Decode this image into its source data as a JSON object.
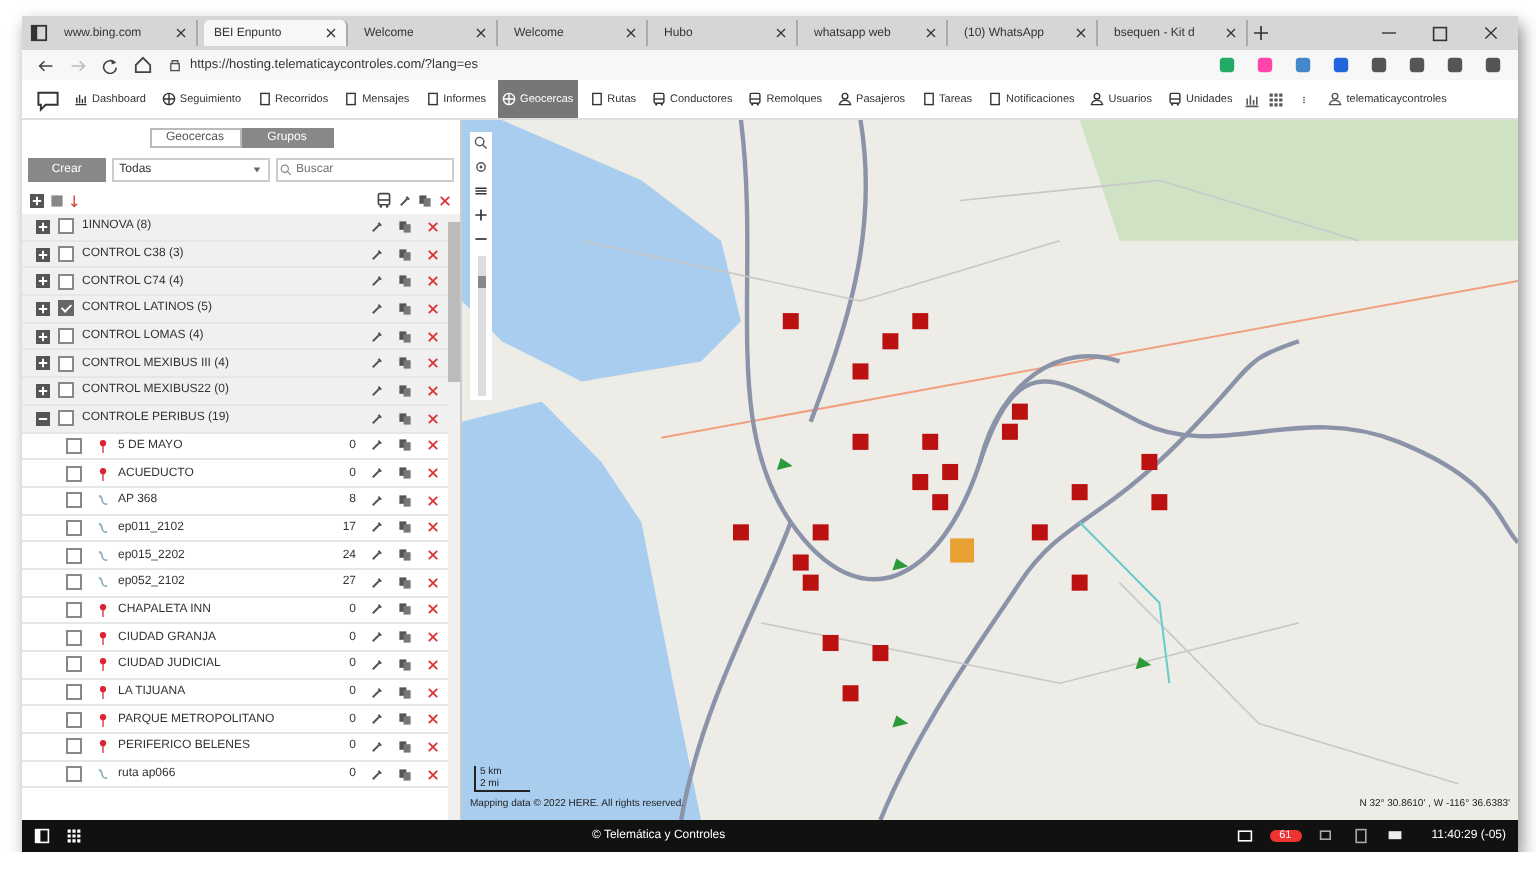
{
  "browser": {
    "tabs": [
      {
        "title": "www.bing.com",
        "selected": false
      },
      {
        "title": "BEI Enpunto",
        "selected": true
      },
      {
        "title": "Welcome",
        "selected": false
      },
      {
        "title": "Welcome",
        "selected": false
      },
      {
        "title": "Hubo",
        "selected": false
      },
      {
        "title": "whatsapp web",
        "selected": false
      },
      {
        "title": "(10) WhatsApp",
        "selected": false
      },
      {
        "title": "bsequen - Kit d",
        "selected": false
      }
    ],
    "url": "https://hosting.telematicaycontroles.com/?lang=es"
  },
  "app_toolbar": {
    "items": [
      {
        "label": "Dashboard",
        "selected": false
      },
      {
        "label": "Seguimiento",
        "selected": false
      },
      {
        "label": "Recorridos",
        "selected": false
      },
      {
        "label": "Mensajes",
        "selected": false
      },
      {
        "label": "Informes",
        "selected": false
      },
      {
        "label": "Geocercas",
        "selected": true
      },
      {
        "label": "Rutas",
        "selected": false
      },
      {
        "label": "Conductores",
        "selected": false
      },
      {
        "label": "Remolques",
        "selected": false
      },
      {
        "label": "Pasajeros",
        "selected": false
      },
      {
        "label": "Tareas",
        "selected": false
      },
      {
        "label": "Notificaciones",
        "selected": false
      },
      {
        "label": "Usuarios",
        "selected": false
      },
      {
        "label": "Unidades",
        "selected": false
      }
    ],
    "user": "telematicaycontroles"
  },
  "panel": {
    "toggle": [
      {
        "label": "Geocercas",
        "selected": false
      },
      {
        "label": "Grupos",
        "selected": true
      }
    ],
    "create_button": "Crear",
    "filter": "Todas",
    "search": {
      "placeholder": "Buscar"
    },
    "groups": [
      {
        "name": "1INNOVA (8)",
        "checked": false,
        "expanded": false
      },
      {
        "name": "CONTROL C38 (3)",
        "checked": false,
        "expanded": false
      },
      {
        "name": "CONTROL C74 (4)",
        "checked": false,
        "expanded": false
      },
      {
        "name": "CONTROL LATINOS (5)",
        "checked": true,
        "expanded": false
      },
      {
        "name": "CONTROL LOMAS (4)",
        "checked": false,
        "expanded": false
      },
      {
        "name": "CONTROL MEXIBUS III (4)",
        "checked": false,
        "expanded": false
      },
      {
        "name": "CONTROL MEXIBUS22 (0)",
        "checked": false,
        "expanded": false
      },
      {
        "name": "CONTROLE PERIBUS (19)",
        "checked": false,
        "expanded": true,
        "children": [
          {
            "name": "5 DE MAYO",
            "kind": "pin",
            "count": "0",
            "checked": false
          },
          {
            "name": "ACUEDUCTO",
            "kind": "pin",
            "count": "0",
            "checked": false
          },
          {
            "name": "AP 368",
            "kind": "route",
            "count": "8",
            "checked": false
          },
          {
            "name": "ep011_2102",
            "kind": "route",
            "count": "17",
            "checked": false
          },
          {
            "name": "ep015_2202",
            "kind": "route",
            "count": "24",
            "checked": false
          },
          {
            "name": "ep052_2102",
            "kind": "route",
            "count": "27",
            "checked": false
          },
          {
            "name": "CHAPALETA INN",
            "kind": "pin",
            "count": "0",
            "checked": false
          },
          {
            "name": "CIUDAD GRANJA",
            "kind": "pin",
            "count": "0",
            "checked": false
          },
          {
            "name": "CIUDAD JUDICIAL",
            "kind": "pin",
            "count": "0",
            "checked": false
          },
          {
            "name": "LA TIJUANA",
            "kind": "pin",
            "count": "0",
            "checked": false
          },
          {
            "name": "PARQUE METROPOLITANO",
            "kind": "pin",
            "count": "0",
            "checked": false
          },
          {
            "name": "PERIFERICO BELENES",
            "kind": "pin",
            "count": "0",
            "checked": false
          },
          {
            "name": "ruta ap066",
            "kind": "route",
            "count": "0",
            "checked": false
          }
        ]
      }
    ]
  },
  "map": {
    "zoom": {
      "level": 0.85
    },
    "scale": [
      "5 km",
      "2 mi"
    ],
    "attribution": "Mapping data © 2022 HERE. All rights reserved.",
    "coordinates": "N 32° 30.8610' , W -116° 36.6383'"
  },
  "taskbar": {
    "footer": "© Telemática y Controles",
    "badge": "61",
    "clock": "11:40:29 (-05)"
  }
}
